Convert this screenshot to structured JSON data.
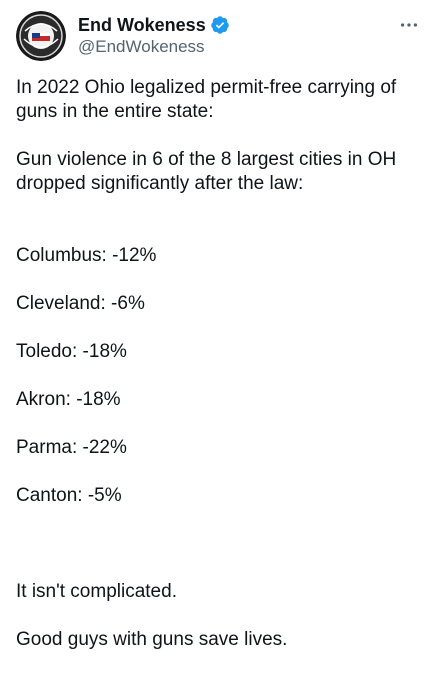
{
  "author": {
    "display_name": "End Wokeness",
    "handle": "@EndWokeness",
    "verified": true,
    "badge_color": "#1d9bf0",
    "avatar_icon": "patch-logo-icon"
  },
  "menu": {
    "icon": "more-horizontal-icon"
  },
  "tweet": {
    "intro": "In 2022 Ohio legalized permit-free carrying of guns in the entire state:",
    "claim": "Gun violence in 6 of the 8 largest cities in OH dropped significantly after the law:",
    "stats": [
      "Columbus: -12%",
      "Cleveland: -6%",
      "Toledo: -18%",
      "Akron: -18%",
      "Parma: -22%",
      "Canton: -5%"
    ],
    "closing_1": "It isn't complicated.",
    "closing_2": "Good guys with guns save lives."
  }
}
